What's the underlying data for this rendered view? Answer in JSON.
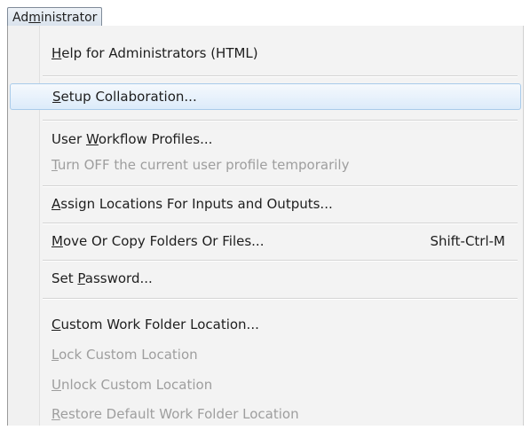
{
  "menu": {
    "title_pre": "Ad",
    "title_key": "m",
    "title_post": "inistrator"
  },
  "items": [
    {
      "pre": "",
      "key": "H",
      "post": "elp for Administrators (HTML)",
      "shortcut": "",
      "enabled": true
    },
    {
      "pre": "",
      "key": "S",
      "post": "etup Collaboration...",
      "shortcut": "",
      "enabled": true,
      "highlighted": true
    },
    {
      "pre": "User ",
      "key": "W",
      "post": "orkflow Profiles...",
      "shortcut": "",
      "enabled": true
    },
    {
      "pre": "",
      "key": "T",
      "post": "urn OFF the current user profile temporarily",
      "shortcut": "",
      "enabled": false
    },
    {
      "pre": "",
      "key": "A",
      "post": "ssign Locations For Inputs and Outputs...",
      "shortcut": "",
      "enabled": true
    },
    {
      "pre": "",
      "key": "M",
      "post": "ove Or Copy Folders Or Files...",
      "shortcut": "Shift-Ctrl-M",
      "enabled": true
    },
    {
      "pre": "Set ",
      "key": "P",
      "post": "assword...",
      "shortcut": "",
      "enabled": true
    },
    {
      "pre": "",
      "key": "C",
      "post": "ustom Work Folder Location...",
      "shortcut": "",
      "enabled": true
    },
    {
      "pre": "",
      "key": "L",
      "post": "ock Custom Location",
      "shortcut": "",
      "enabled": false
    },
    {
      "pre": "",
      "key": "U",
      "post": "nlock Custom Location",
      "shortcut": "",
      "enabled": false
    },
    {
      "pre": "",
      "key": "R",
      "post": "estore Default Work Folder Location",
      "shortcut": "",
      "enabled": false
    }
  ]
}
